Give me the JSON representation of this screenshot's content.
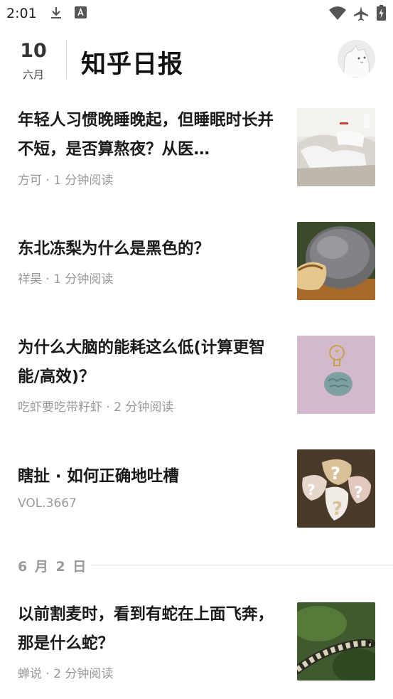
{
  "status_bar": {
    "time": "2:01",
    "icons": [
      "download-icon",
      "accessibility-icon",
      "wifi-icon",
      "airplane-mode-icon",
      "battery-charging-icon"
    ]
  },
  "header": {
    "day": "10",
    "month": "六月",
    "title": "知乎日报",
    "avatar_icon": "cat-avatar-icon"
  },
  "stories": [
    {
      "title": "年轻人习惯晚睡晚起，但睡眠时长并不短，是否算熬夜？从医…",
      "meta": "方可 · 1 分钟阅读",
      "image": "messy-bed-photo"
    },
    {
      "title": "东北冻梨为什么是黑色的？",
      "meta": "祥昊 · 1 分钟阅读",
      "image": "frozen-pear-photo"
    },
    {
      "title": "为什么大脑的能耗这么低(计算更智能/高效)？",
      "meta": "吃虾要吃带籽虾 · 2 分钟阅读",
      "image": "brain-lightbulb-photo"
    },
    {
      "title": "瞎扯 · 如何正确地吐槽",
      "meta": "VOL.3667",
      "image": "question-marks-photo"
    }
  ],
  "section": {
    "date_label": "6 月 2 日"
  },
  "section_stories": [
    {
      "title": "以前割麦时，看到有蛇在上面飞奔，那是什么蛇？",
      "meta": "蝉说 · 2 分钟阅读",
      "image": "snake-photo"
    }
  ],
  "colors": {
    "meta_text": "#9a9a9a",
    "title_text": "#1a1a1a",
    "divider": "#e3e3e3"
  }
}
